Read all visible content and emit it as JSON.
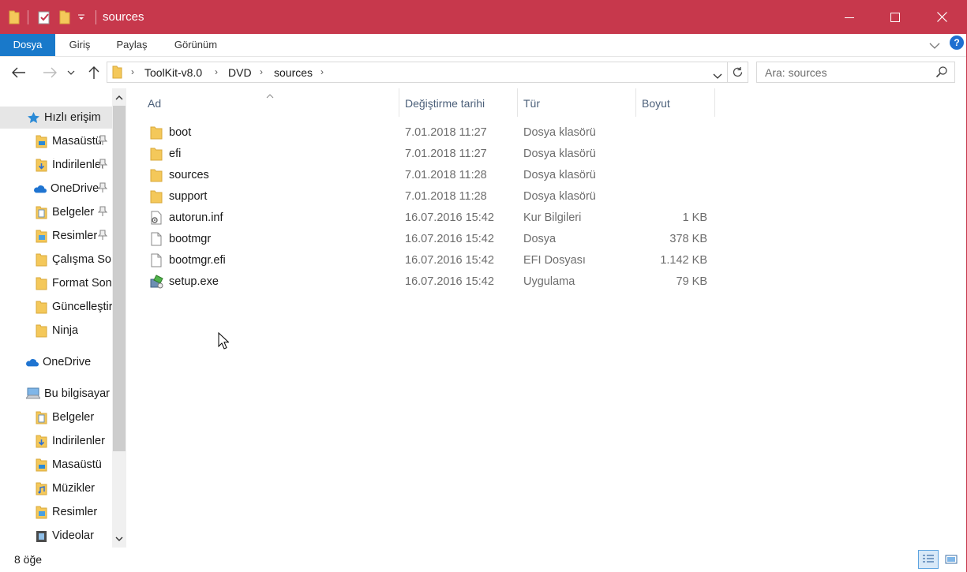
{
  "window": {
    "title": "sources",
    "accent": "#c7384c"
  },
  "ribbon": {
    "tabs": [
      {
        "label": "Dosya",
        "active": true
      },
      {
        "label": "Giriş",
        "active": false
      },
      {
        "label": "Paylaş",
        "active": false
      },
      {
        "label": "Görünüm",
        "active": false
      }
    ],
    "help": "?"
  },
  "address": {
    "crumbs": [
      "ToolKit-v8.0",
      "DVD",
      "sources"
    ]
  },
  "search": {
    "placeholder": "Ara: sources"
  },
  "nav": {
    "items": [
      {
        "label": "Hızlı erişim",
        "icon": "star-icon",
        "pinned": false
      },
      {
        "label": "Masaüstü",
        "icon": "desktop-folder-icon",
        "pinned": true
      },
      {
        "label": "İndirilenler",
        "icon": "downloads-folder-icon",
        "pinned": true
      },
      {
        "label": "OneDrive",
        "icon": "onedrive-cloud-icon",
        "pinned": true
      },
      {
        "label": "Belgeler",
        "icon": "documents-folder-icon",
        "pinned": true
      },
      {
        "label": "Resimler",
        "icon": "pictures-folder-icon",
        "pinned": true
      },
      {
        "label": "Çalışma Sonuçları",
        "icon": "folder-icon",
        "pinned": false
      },
      {
        "label": "Format Sonrası",
        "icon": "folder-icon",
        "pinned": false
      },
      {
        "label": "Güncelleştirmeler",
        "icon": "folder-icon",
        "pinned": false
      },
      {
        "label": "Ninja",
        "icon": "folder-icon",
        "pinned": false
      },
      {
        "label": "OneDrive",
        "icon": "onedrive-cloud-icon",
        "pinned": false
      },
      {
        "label": "Bu bilgisayar",
        "icon": "computer-icon",
        "pinned": false
      },
      {
        "label": "Belgeler",
        "icon": "documents-folder-icon",
        "pinned": false
      },
      {
        "label": "İndirilenler",
        "icon": "downloads-folder-icon",
        "pinned": false
      },
      {
        "label": "Masaüstü",
        "icon": "desktop-folder-icon",
        "pinned": false
      },
      {
        "label": "Müzikler",
        "icon": "music-folder-icon",
        "pinned": false
      },
      {
        "label": "Resimler",
        "icon": "pictures-folder-icon",
        "pinned": false
      },
      {
        "label": "Videolar",
        "icon": "videos-folder-icon",
        "pinned": false
      }
    ]
  },
  "columns": {
    "name": "Ad",
    "date": "Değiştirme tarihi",
    "type": "Tür",
    "size": "Boyut"
  },
  "files": [
    {
      "name": "boot",
      "date": "7.01.2018 11:27",
      "type": "Dosya klasörü",
      "size": "",
      "icon": "folder-icon"
    },
    {
      "name": "efi",
      "date": "7.01.2018 11:27",
      "type": "Dosya klasörü",
      "size": "",
      "icon": "folder-icon"
    },
    {
      "name": "sources",
      "date": "7.01.2018 11:28",
      "type": "Dosya klasörü",
      "size": "",
      "icon": "folder-icon"
    },
    {
      "name": "support",
      "date": "7.01.2018 11:28",
      "type": "Dosya klasörü",
      "size": "",
      "icon": "folder-icon"
    },
    {
      "name": "autorun.inf",
      "date": "16.07.2016 15:42",
      "type": "Kur Bilgileri",
      "size": "1 KB",
      "icon": "settings-file-icon"
    },
    {
      "name": "bootmgr",
      "date": "16.07.2016 15:42",
      "type": "Dosya",
      "size": "378 KB",
      "icon": "blank-file-icon"
    },
    {
      "name": "bootmgr.efi",
      "date": "16.07.2016 15:42",
      "type": "EFI Dosyası",
      "size": "1.142 KB",
      "icon": "blank-file-icon"
    },
    {
      "name": "setup.exe",
      "date": "16.07.2016 15:42",
      "type": "Uygulama",
      "size": "79 KB",
      "icon": "setup-app-icon"
    }
  ],
  "status": {
    "count": "8 öğe"
  }
}
